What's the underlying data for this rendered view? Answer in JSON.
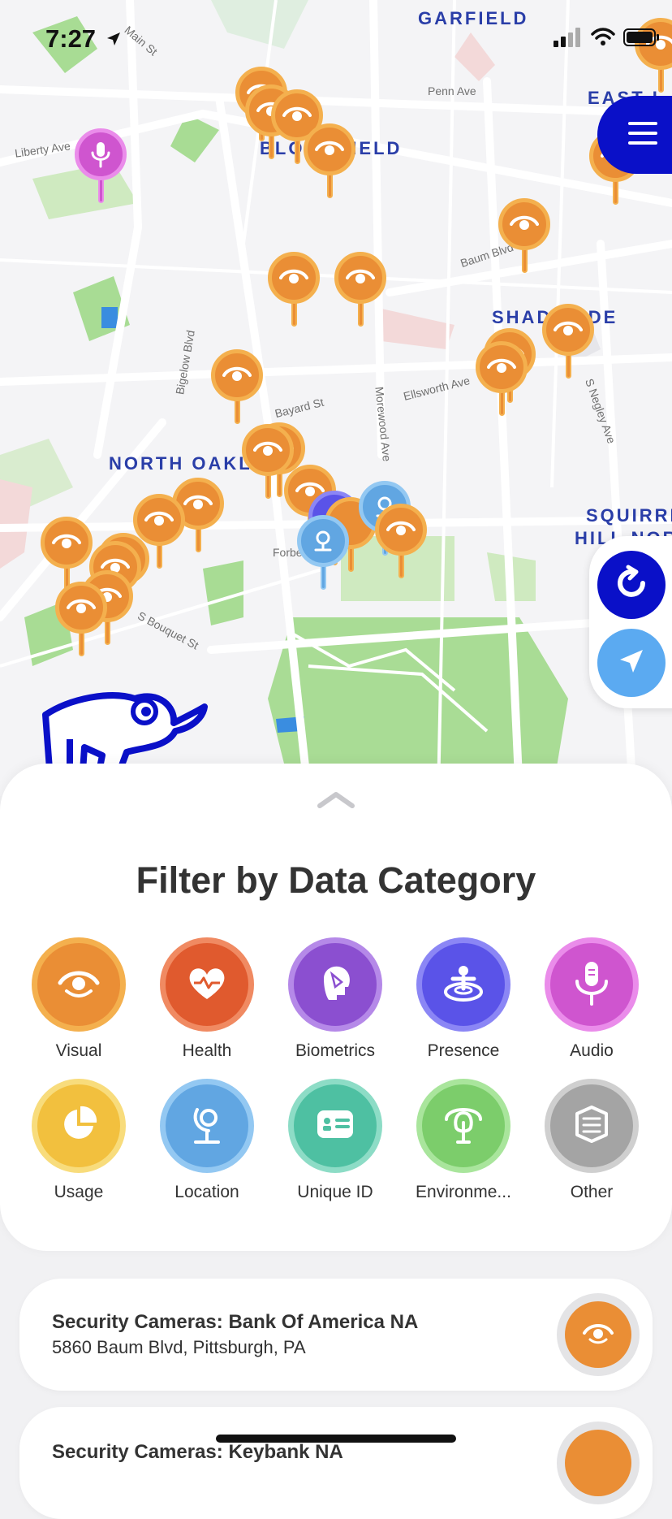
{
  "status_bar": {
    "time": "7:27"
  },
  "map": {
    "neighborhoods": [
      "GARFIELD",
      "EAST L",
      "BLOOMFIELD",
      "SHADYSIDE",
      "NORTH OAKLAND",
      "SQUIRREL",
      "HILL NORTH"
    ],
    "streets": [
      "Main St",
      "Liberty Ave",
      "Penn Ave",
      "Baum Blvd",
      "Bigelow Blvd",
      "Bayard St",
      "Morewood Ave",
      "Ellsworth Ave",
      "S Negley Ave",
      "Forbes Ave",
      "S Bouquet St"
    ]
  },
  "colors": {
    "accent": "#0a10c8",
    "visual": "#ea8e35",
    "health": "#e05a2e",
    "biometrics": "#8b4fd0",
    "presence": "#5a53e8",
    "audio": "#cf55cf",
    "usage": "#f2c03e",
    "location": "#61a6e2",
    "unique_id": "#4ec0a2",
    "environment": "#7ccd6b",
    "other": "#a4a4a4"
  },
  "filter": {
    "title": "Filter by Data Category",
    "categories": [
      {
        "label": "Visual",
        "icon": "eye-icon"
      },
      {
        "label": "Health",
        "icon": "heart-icon"
      },
      {
        "label": "Biometrics",
        "icon": "face-icon"
      },
      {
        "label": "Presence",
        "icon": "presence-icon"
      },
      {
        "label": "Audio",
        "icon": "microphone-icon"
      },
      {
        "label": "Usage",
        "icon": "pie-chart-icon"
      },
      {
        "label": "Location",
        "icon": "globe-icon"
      },
      {
        "label": "Unique ID",
        "icon": "id-card-icon"
      },
      {
        "label": "Environme...",
        "icon": "tree-icon"
      },
      {
        "label": "Other",
        "icon": "layers-icon"
      }
    ]
  },
  "results": [
    {
      "title": "Security Cameras: Bank Of America NA",
      "address": "5860 Baum Blvd, Pittsburgh, PA",
      "icon": "eye-icon"
    },
    {
      "title": "Security Cameras: Keybank NA",
      "address": "",
      "icon": "eye-icon"
    }
  ]
}
